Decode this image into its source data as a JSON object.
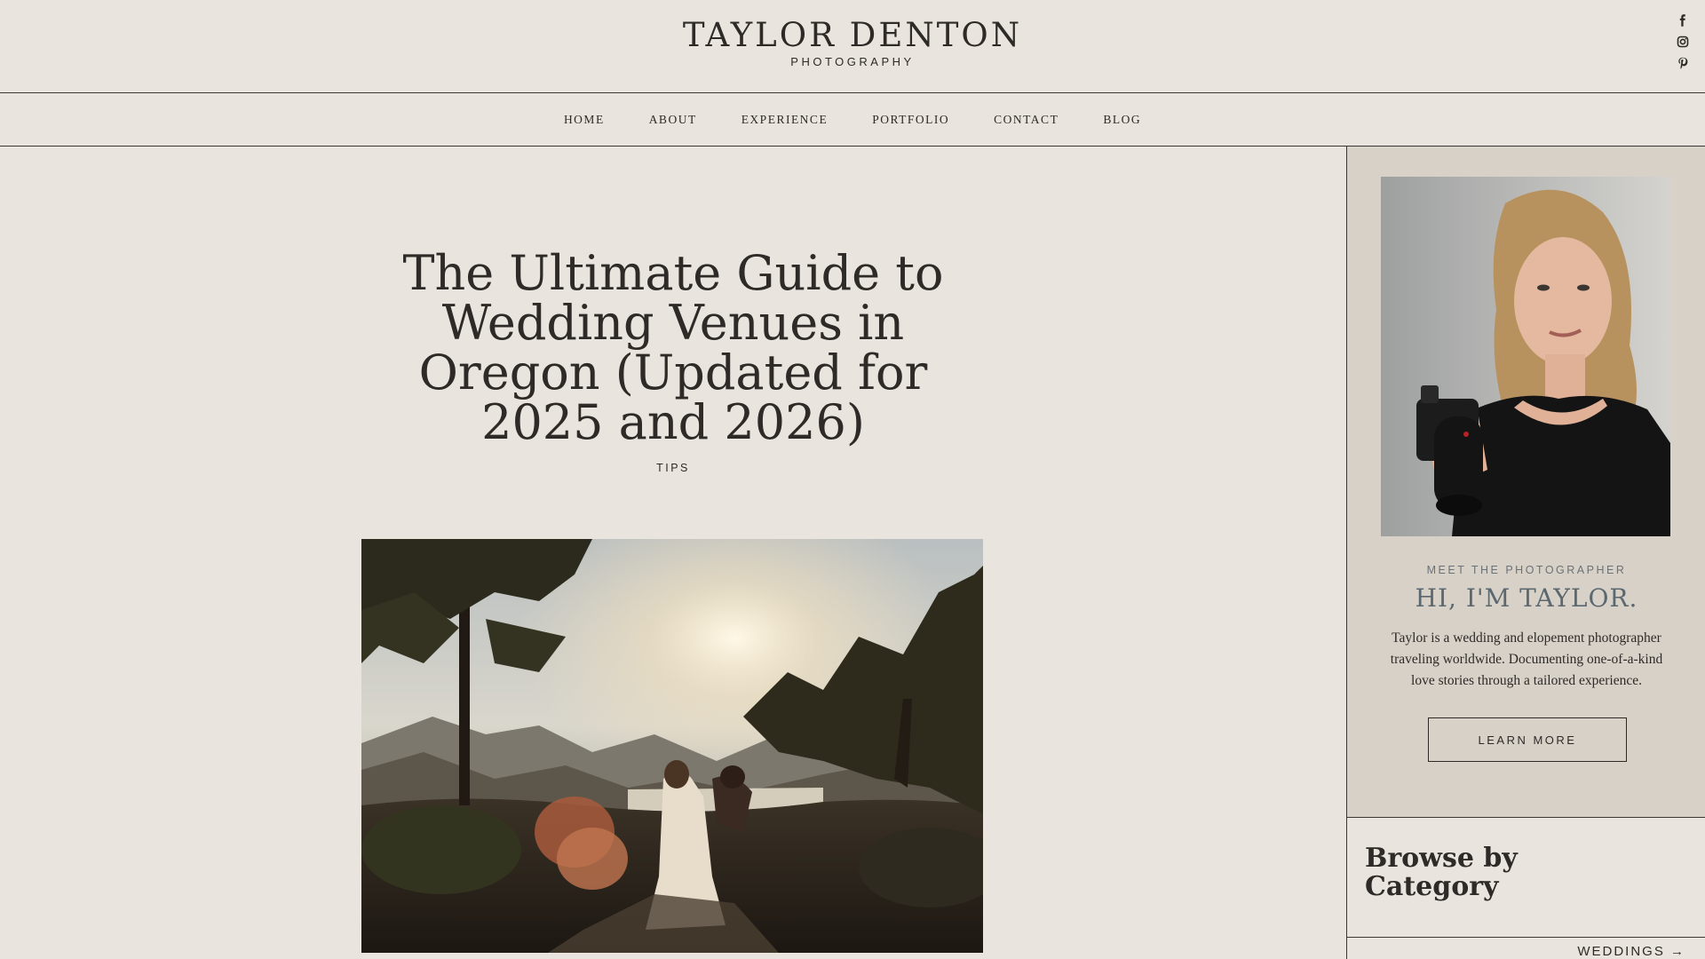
{
  "brand": {
    "name": "TAYLOR DENTON",
    "sub": "PHOTOGRAPHY"
  },
  "social": [
    {
      "icon": "facebook-icon"
    },
    {
      "icon": "instagram-icon"
    },
    {
      "icon": "pinterest-icon"
    }
  ],
  "nav": {
    "items": [
      {
        "label": "HOME"
      },
      {
        "label": "ABOUT"
      },
      {
        "label": "EXPERIENCE"
      },
      {
        "label": "PORTFOLIO"
      },
      {
        "label": "CONTACT"
      },
      {
        "label": "BLOG"
      }
    ]
  },
  "post": {
    "title": "The Ultimate Guide to Wedding Venues in Oregon (Updated for 2025 and 2026)",
    "category": "TIPS"
  },
  "sidebar": {
    "meet": "MEET THE PHOTOGRAPHER",
    "heading": "HI, I'M TAYLOR.",
    "bio": "Taylor is a wedding and elopement photographer traveling worldwide. Documenting one-of-a-kind love stories through a tailored experience.",
    "button": "LEARN MORE",
    "browse_title": "Browse by Category",
    "categories": [
      {
        "label": "WEDDINGS →"
      }
    ]
  },
  "colors": {
    "background": "#e9e5de",
    "sidebar_card": "#d8d1c8",
    "accent_text": "#5b6870",
    "ink": "#2d2a27"
  }
}
